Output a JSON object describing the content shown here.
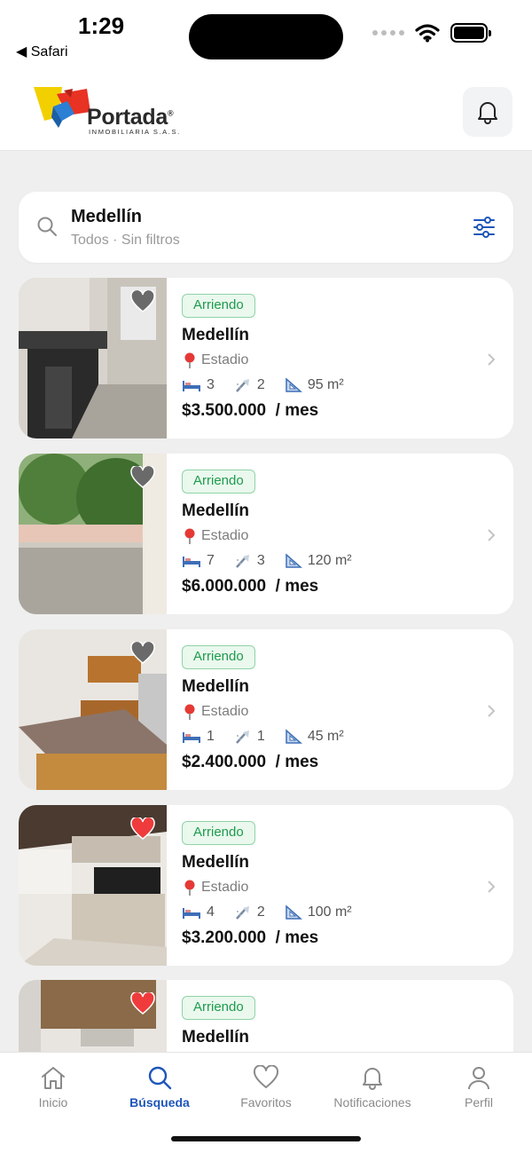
{
  "status_bar": {
    "time": "1:29",
    "back_app": "◀ Safari"
  },
  "header": {
    "logo_text": "Portada",
    "logo_registered": "®",
    "logo_subtitle": "INMOBILIARIA S.A.S."
  },
  "search": {
    "title": "Medellín",
    "subtitle": "Todos · Sin filtros"
  },
  "listings": [
    {
      "badge": "Arriendo",
      "city": "Medellín",
      "location": "Estadio",
      "beds": "3",
      "baths": "2",
      "area": "95 m²",
      "price": "$3.500.000",
      "period": "/ mes",
      "favorite": false
    },
    {
      "badge": "Arriendo",
      "city": "Medellín",
      "location": "Estadio",
      "beds": "7",
      "baths": "3",
      "area": "120 m²",
      "price": "$6.000.000",
      "period": "/ mes",
      "favorite": false
    },
    {
      "badge": "Arriendo",
      "city": "Medellín",
      "location": "Estadio",
      "beds": "1",
      "baths": "1",
      "area": "45 m²",
      "price": "$2.400.000",
      "period": "/ mes",
      "favorite": false
    },
    {
      "badge": "Arriendo",
      "city": "Medellín",
      "location": "Estadio",
      "beds": "4",
      "baths": "2",
      "area": "100 m²",
      "price": "$3.200.000",
      "period": "/ mes",
      "favorite": true
    },
    {
      "badge": "Arriendo",
      "city": "Medellín",
      "favorite": true
    }
  ],
  "tabs": [
    {
      "label": "Inicio",
      "icon": "home-icon"
    },
    {
      "label": "Búsqueda",
      "icon": "search-icon",
      "active": true
    },
    {
      "label": "Favoritos",
      "icon": "heart-icon"
    },
    {
      "label": "Notificaciones",
      "icon": "bell-icon"
    },
    {
      "label": "Perfil",
      "icon": "user-icon"
    }
  ],
  "colors": {
    "accent": "#1e56b9",
    "badge_green": "#1e9b4c",
    "favorite_red": "#ef3b3b",
    "favorite_gray": "#6a6a6a"
  }
}
